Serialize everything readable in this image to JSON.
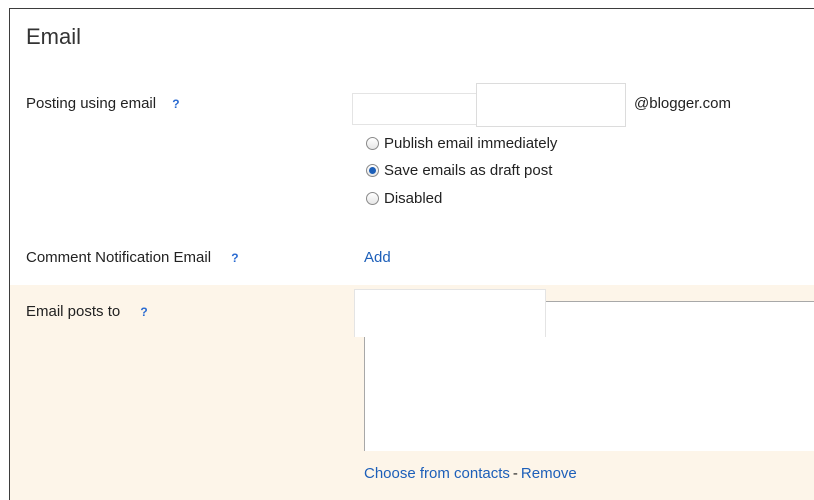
{
  "section": {
    "title": "Email"
  },
  "posting": {
    "label": "Posting using email",
    "help": "?",
    "input_value": "",
    "suffix": "@blogger.com",
    "options": [
      {
        "label": "Publish email immediately",
        "checked": false
      },
      {
        "label": "Save emails as draft post",
        "checked": true
      },
      {
        "label": "Disabled",
        "checked": false
      }
    ]
  },
  "comment_notification": {
    "label": "Comment Notification Email",
    "help": "?",
    "add_link": "Add"
  },
  "email_posts": {
    "label": "Email posts to",
    "help": "?",
    "textarea_value": "",
    "choose_link": "Choose from contacts",
    "separator": "-",
    "remove_link": "Remove"
  },
  "colors": {
    "link": "#1d5fb9",
    "highlight_bg": "#fdf5e9"
  }
}
